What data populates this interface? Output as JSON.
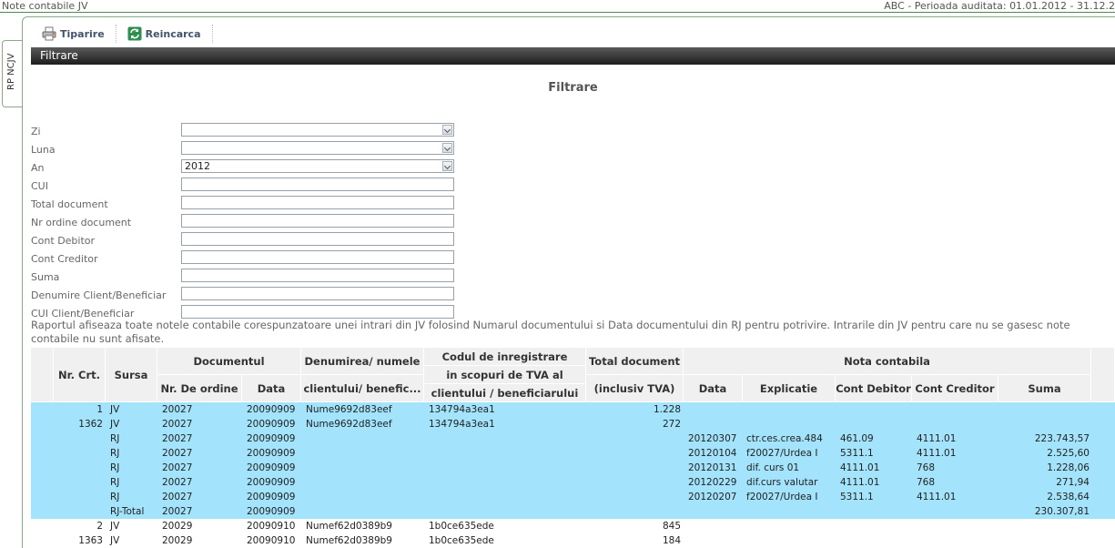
{
  "window": {
    "title": "Note contabile JV",
    "period": "ABC - Perioada auditata: 01.01.2012 - 31.12.2"
  },
  "sidetab": {
    "label": "RP NCJV"
  },
  "toolbar": {
    "print_label": "Tiparire",
    "reload_label": "Reincarca"
  },
  "section": {
    "title": "Filtrare"
  },
  "filter": {
    "title": "Filtrare",
    "fields": [
      {
        "label": "Zi",
        "value": "",
        "type": "select"
      },
      {
        "label": "Luna",
        "value": "",
        "type": "select"
      },
      {
        "label": "An",
        "value": "2012",
        "type": "select"
      },
      {
        "label": "CUI",
        "value": "",
        "type": "text"
      },
      {
        "label": "Total document",
        "value": "",
        "type": "text"
      },
      {
        "label": "Nr ordine document",
        "value": "",
        "type": "text"
      },
      {
        "label": "Cont Debitor",
        "value": "",
        "type": "text"
      },
      {
        "label": "Cont Creditor",
        "value": "",
        "type": "text"
      },
      {
        "label": "Suma",
        "value": "",
        "type": "text"
      },
      {
        "label": "Denumire Client/Beneficiar",
        "value": "",
        "type": "text"
      },
      {
        "label": "CUI Client/Beneficiar",
        "value": "",
        "type": "text"
      }
    ]
  },
  "note": "Raportul afiseaza toate notele contabile corespunzatoare unei intrari din JV folosind Numarul documentului si Data documentului din RJ pentru potrivire. Intrarile din JV pentru care nu se gasesc note contabile nu sunt afisate.",
  "table": {
    "headers": {
      "nr_crt": "Nr. Crt.",
      "sursa": "Sursa",
      "documentul": "Documentul",
      "nr_ordine": "Nr. De ordine",
      "data": "Data",
      "denumire_1": "Denumirea/ numele",
      "denumire_2": "clientului/ benefic...",
      "cod_1": "Codul de inregistrare",
      "cod_2": "in scopuri de TVA al",
      "cod_3": "clientului / beneficiarului",
      "total_1": "Total document",
      "total_2": "(inclusiv TVA)",
      "nota": "Nota contabila",
      "nota_data": "Data",
      "explicatie": "Explicatie",
      "cont_debitor": "Cont Debitor",
      "cont_creditor": "Cont Creditor",
      "suma": "Suma"
    },
    "rows": [
      {
        "sel": true,
        "nr": "1",
        "sursa": "JV",
        "ordine": "20027",
        "data": "20090909",
        "den": "Nume9692d83eef",
        "cod": "134794a3ea1",
        "total": "1.228",
        "ndata": "",
        "expl": "",
        "deb": "",
        "cred": "",
        "suma": ""
      },
      {
        "sel": true,
        "nr": "1362",
        "sursa": "JV",
        "ordine": "20027",
        "data": "20090909",
        "den": "Nume9692d83eef",
        "cod": "134794a3ea1",
        "total": "272",
        "ndata": "",
        "expl": "",
        "deb": "",
        "cred": "",
        "suma": ""
      },
      {
        "sel": true,
        "nr": "",
        "sursa": "RJ",
        "ordine": "20027",
        "data": "20090909",
        "den": "",
        "cod": "",
        "total": "",
        "ndata": "20120307",
        "expl": "ctr.ces.crea.484",
        "deb": "461.09",
        "cred": "4111.01",
        "suma": "223.743,57"
      },
      {
        "sel": true,
        "nr": "",
        "sursa": "RJ",
        "ordine": "20027",
        "data": "20090909",
        "den": "",
        "cod": "",
        "total": "",
        "ndata": "20120104",
        "expl": "f20027/Urdea I",
        "deb": "5311.1",
        "cred": "4111.01",
        "suma": "2.525,60"
      },
      {
        "sel": true,
        "nr": "",
        "sursa": "RJ",
        "ordine": "20027",
        "data": "20090909",
        "den": "",
        "cod": "",
        "total": "",
        "ndata": "20120131",
        "expl": "dif. curs 01",
        "deb": "4111.01",
        "cred": "768",
        "suma": "1.228,06"
      },
      {
        "sel": true,
        "nr": "",
        "sursa": "RJ",
        "ordine": "20027",
        "data": "20090909",
        "den": "",
        "cod": "",
        "total": "",
        "ndata": "20120229",
        "expl": "dif.curs valutar",
        "deb": "4111.01",
        "cred": "768",
        "suma": "271,94"
      },
      {
        "sel": true,
        "nr": "",
        "sursa": "RJ",
        "ordine": "20027",
        "data": "20090909",
        "den": "",
        "cod": "",
        "total": "",
        "ndata": "20120207",
        "expl": "f20027/Urdea I",
        "deb": "5311.1",
        "cred": "4111.01",
        "suma": "2.538,64"
      },
      {
        "sel": true,
        "nr": "",
        "sursa": "RJ-Total",
        "ordine": "20027",
        "data": "20090909",
        "den": "",
        "cod": "",
        "total": "",
        "ndata": "",
        "expl": "",
        "deb": "",
        "cred": "",
        "suma": "230.307,81"
      },
      {
        "sel": false,
        "nr": "2",
        "sursa": "JV",
        "ordine": "20029",
        "data": "20090910",
        "den": "Numef62d0389b9",
        "cod": "1b0ce635ede",
        "total": "845",
        "ndata": "",
        "expl": "",
        "deb": "",
        "cred": "",
        "suma": ""
      },
      {
        "sel": false,
        "nr": "1363",
        "sursa": "JV",
        "ordine": "20029",
        "data": "20090910",
        "den": "Numef62d0389b9",
        "cod": "1b0ce635ede",
        "total": "184",
        "ndata": "",
        "expl": "",
        "deb": "",
        "cred": "",
        "suma": ""
      }
    ]
  },
  "colors": {
    "selected_row": "#a3e4fc",
    "header_bg": "#f0f0f0",
    "section_bar": "#2b2b2b"
  }
}
